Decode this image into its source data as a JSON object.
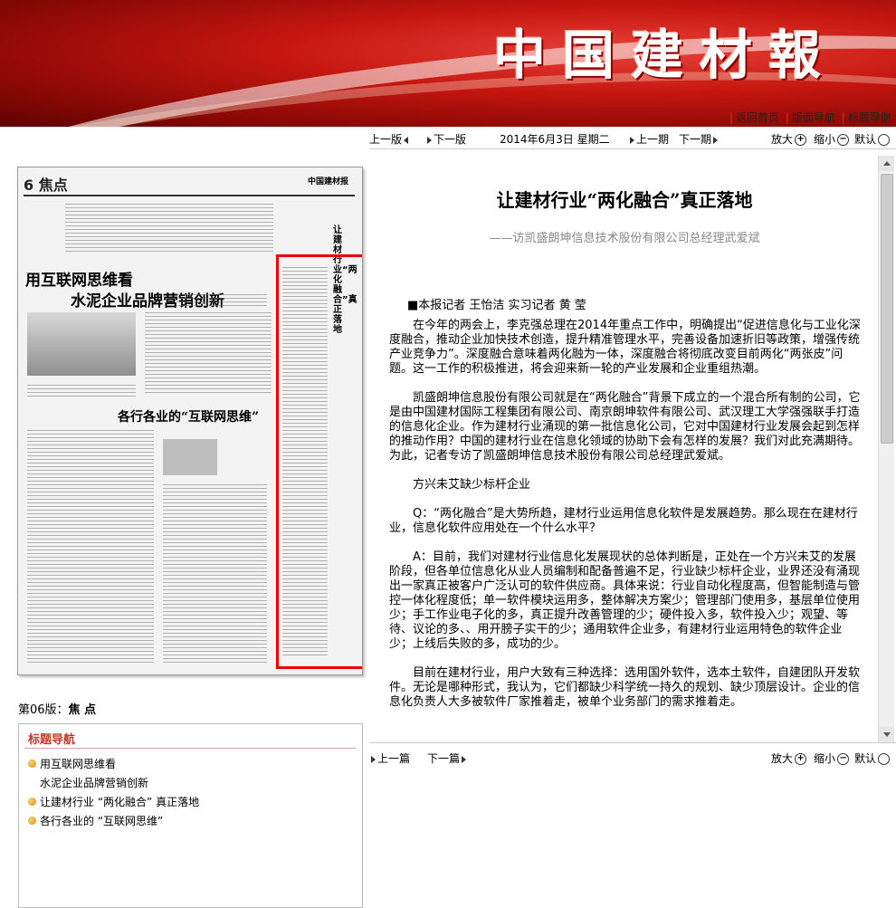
{
  "header": {
    "logo": "中国建材報",
    "nav": [
      "返回首页",
      "版面导航",
      "标题导航"
    ]
  },
  "paper": {
    "page_label": "6 焦点",
    "masthead": "中国建材报",
    "headline1": "用互联网思维看",
    "headline2": "水泥企业品牌营销创新",
    "headline3": "各行各业的“互联网思维”",
    "vertical_title": "让建材行业“两化融合”真正落地"
  },
  "version": {
    "label": "第06版：",
    "name": "焦 点"
  },
  "title_nav": {
    "title": "标题导航",
    "items": [
      {
        "line1": "用互联网思维看",
        "line2": "水泥企业品牌营销创新"
      },
      {
        "line1": "让建材行业 “两化融合” 真正落地"
      },
      {
        "line1": "各行各业的 “互联网思维”"
      }
    ]
  },
  "toolbar": {
    "prev_page": "上一版",
    "next_page": "下一版",
    "date": "2014年6月3日  星期二",
    "prev_issue": "上一期",
    "next_issue": "下一期",
    "zoom_in": "放大",
    "zoom_out": "缩小",
    "default": "默认"
  },
  "bottombar": {
    "prev_article": "上一篇",
    "next_article": "下一篇",
    "zoom_in": "放大",
    "zoom_out": "缩小",
    "default": "默认"
  },
  "article": {
    "title": "让建材行业“两化融合”真正落地",
    "subtitle": "——访凯盛朗坤信息技术股份有限公司总经理武爱斌",
    "byline": "■本报记者  王怡洁  实习记者  黄  莹",
    "paragraphs": [
      "在今年的两会上，李克强总理在2014年重点工作中，明确提出“促进信息化与工业化深度融合，推动企业加快技术创造，提升精准管理水平，完善设备加速折旧等政策，增强传统产业竞争力”。深度融合意味着两化融为一体，深度融合将彻底改变目前两化“两张皮”问题。这一工作的积极推进，将会迎来新一轮的产业发展和企业重组热潮。",
      "凯盛朗坤信息股份有限公司就是在“两化融合”背景下成立的一个混合所有制的公司，它是由中国建材国际工程集团有限公司、南京朗坤软件有限公司、武汉理工大学强强联手打造的信息化企业。作为建材行业涌现的第一批信息化公司，它对中国建材行业发展会起到怎样的推动作用？中国的建材行业在信息化领域的协助下会有怎样的发展？我们对此充满期待。为此，记者专访了凯盛朗坤信息技术股份有限公司总经理武爱斌。",
      "方兴未艾缺少标杆企业",
      "Q：“两化融合”是大势所趋，建材行业运用信息化软件是发展趋势。那么现在在建材行业，信息化软件应用处在一个什么水平？",
      "A：目前，我们对建材行业信息化发展现状的总体判断是，正处在一个方兴未艾的发展阶段，但各单位信息化从业人员编制和配备普遍不足，行业缺少标杆企业，业界还没有涌现出一家真正被客户广泛认可的软件供应商。具体来说：行业自动化程度高，但智能制造与管控一体化程度低；单一软件模块运用多，整体解决方案少；管理部门使用多，基层单位使用少；手工作业电子化的多，真正提升改善管理的少；硬件投入多，软件投入少；观望、等待、议论的多、、用开膀子实干的少；通用软件企业多，有建材行业运用特色的软件企业少；上线后失败的多，成功的少。",
      "目前在建材行业，用户大致有三种选择：选用国外软件，选本土软件，自建团队开发软件。无论是哪种形式，我认为，它们都缺少科学统一持久的规划、缺少顶层设计。企业的信息化负责人大多被软件厂家推着走，被单个业务部门的需求推着走。"
    ]
  }
}
